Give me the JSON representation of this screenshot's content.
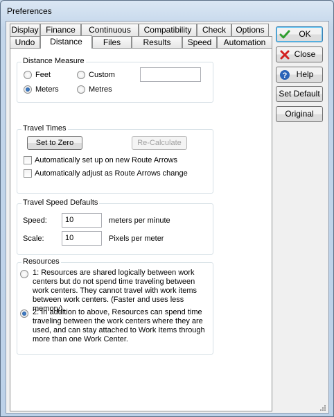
{
  "window": {
    "title": "Preferences"
  },
  "tabs": {
    "row_top": [
      "Display",
      "Finance",
      "Continuous",
      "Compatibility",
      "Check",
      "Options"
    ],
    "row_bottom": [
      "Undo",
      "Distance",
      "Files",
      "Results",
      "Speed",
      "Automation"
    ],
    "active": "Distance"
  },
  "distance_measure": {
    "title": "Distance Measure",
    "options": [
      {
        "label": "Feet",
        "checked": false
      },
      {
        "label": "Custom",
        "checked": false
      },
      {
        "label": "Meters",
        "checked": true
      },
      {
        "label": "Metres",
        "checked": false
      }
    ],
    "custom_value": ""
  },
  "travel_times": {
    "title": "Travel Times",
    "set_to_zero": "Set to Zero",
    "recalculate": "Re-Calculate",
    "auto_setup": "Automatically set up on new Route Arrows",
    "auto_adjust": "Automatically adjust as Route Arrows change"
  },
  "travel_speed": {
    "title": "Travel Speed Defaults",
    "speed_label": "Speed:",
    "speed_value": "10",
    "speed_unit": "meters per minute",
    "scale_label": "Scale:",
    "scale_value": "10",
    "scale_unit": "Pixels per meter"
  },
  "resources": {
    "title": "Resources",
    "option1": "1: Resources are shared logically between work centers but do not spend time traveling between work centers.  They cannot travel with work items between work centers.  (Faster and uses less memory).",
    "option2": "2: In addition to above, Resources can spend time traveling between the work centers where they are used, and can stay attached to Work Items through more than one Work Center.",
    "selected": 2
  },
  "side_buttons": {
    "ok": "OK",
    "close": "Close",
    "help": "Help",
    "set_default": "Set Default",
    "original": "Original"
  },
  "colors": {
    "ok_check": "#2e9e2e",
    "close_x": "#d22020",
    "help_blue": "#2a63b8"
  }
}
